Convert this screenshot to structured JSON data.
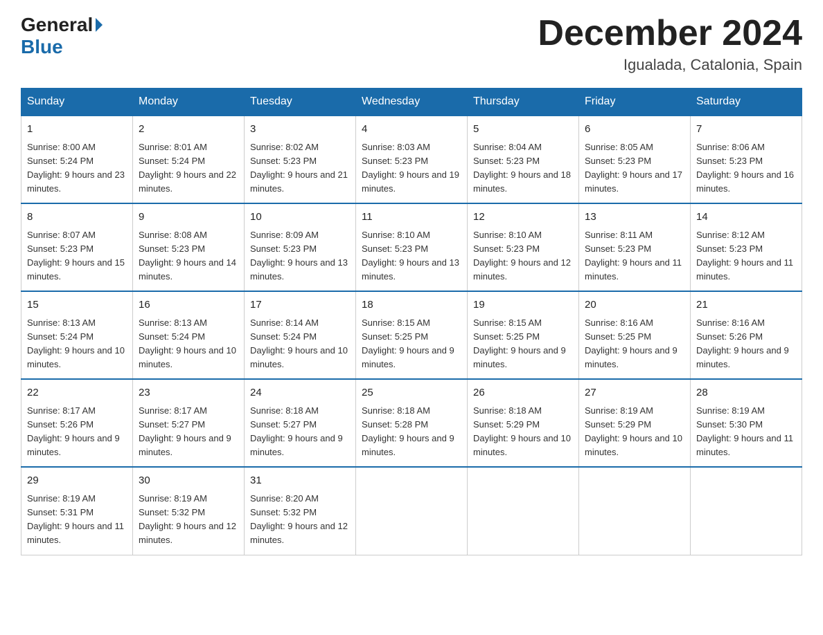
{
  "header": {
    "logo_general": "General",
    "logo_blue": "Blue",
    "title": "December 2024",
    "location": "Igualada, Catalonia, Spain"
  },
  "weekdays": [
    "Sunday",
    "Monday",
    "Tuesday",
    "Wednesday",
    "Thursday",
    "Friday",
    "Saturday"
  ],
  "weeks": [
    [
      {
        "day": "1",
        "sunrise": "8:00 AM",
        "sunset": "5:24 PM",
        "daylight": "9 hours and 23 minutes."
      },
      {
        "day": "2",
        "sunrise": "8:01 AM",
        "sunset": "5:24 PM",
        "daylight": "9 hours and 22 minutes."
      },
      {
        "day": "3",
        "sunrise": "8:02 AM",
        "sunset": "5:23 PM",
        "daylight": "9 hours and 21 minutes."
      },
      {
        "day": "4",
        "sunrise": "8:03 AM",
        "sunset": "5:23 PM",
        "daylight": "9 hours and 19 minutes."
      },
      {
        "day": "5",
        "sunrise": "8:04 AM",
        "sunset": "5:23 PM",
        "daylight": "9 hours and 18 minutes."
      },
      {
        "day": "6",
        "sunrise": "8:05 AM",
        "sunset": "5:23 PM",
        "daylight": "9 hours and 17 minutes."
      },
      {
        "day": "7",
        "sunrise": "8:06 AM",
        "sunset": "5:23 PM",
        "daylight": "9 hours and 16 minutes."
      }
    ],
    [
      {
        "day": "8",
        "sunrise": "8:07 AM",
        "sunset": "5:23 PM",
        "daylight": "9 hours and 15 minutes."
      },
      {
        "day": "9",
        "sunrise": "8:08 AM",
        "sunset": "5:23 PM",
        "daylight": "9 hours and 14 minutes."
      },
      {
        "day": "10",
        "sunrise": "8:09 AM",
        "sunset": "5:23 PM",
        "daylight": "9 hours and 13 minutes."
      },
      {
        "day": "11",
        "sunrise": "8:10 AM",
        "sunset": "5:23 PM",
        "daylight": "9 hours and 13 minutes."
      },
      {
        "day": "12",
        "sunrise": "8:10 AM",
        "sunset": "5:23 PM",
        "daylight": "9 hours and 12 minutes."
      },
      {
        "day": "13",
        "sunrise": "8:11 AM",
        "sunset": "5:23 PM",
        "daylight": "9 hours and 11 minutes."
      },
      {
        "day": "14",
        "sunrise": "8:12 AM",
        "sunset": "5:23 PM",
        "daylight": "9 hours and 11 minutes."
      }
    ],
    [
      {
        "day": "15",
        "sunrise": "8:13 AM",
        "sunset": "5:24 PM",
        "daylight": "9 hours and 10 minutes."
      },
      {
        "day": "16",
        "sunrise": "8:13 AM",
        "sunset": "5:24 PM",
        "daylight": "9 hours and 10 minutes."
      },
      {
        "day": "17",
        "sunrise": "8:14 AM",
        "sunset": "5:24 PM",
        "daylight": "9 hours and 10 minutes."
      },
      {
        "day": "18",
        "sunrise": "8:15 AM",
        "sunset": "5:25 PM",
        "daylight": "9 hours and 9 minutes."
      },
      {
        "day": "19",
        "sunrise": "8:15 AM",
        "sunset": "5:25 PM",
        "daylight": "9 hours and 9 minutes."
      },
      {
        "day": "20",
        "sunrise": "8:16 AM",
        "sunset": "5:25 PM",
        "daylight": "9 hours and 9 minutes."
      },
      {
        "day": "21",
        "sunrise": "8:16 AM",
        "sunset": "5:26 PM",
        "daylight": "9 hours and 9 minutes."
      }
    ],
    [
      {
        "day": "22",
        "sunrise": "8:17 AM",
        "sunset": "5:26 PM",
        "daylight": "9 hours and 9 minutes."
      },
      {
        "day": "23",
        "sunrise": "8:17 AM",
        "sunset": "5:27 PM",
        "daylight": "9 hours and 9 minutes."
      },
      {
        "day": "24",
        "sunrise": "8:18 AM",
        "sunset": "5:27 PM",
        "daylight": "9 hours and 9 minutes."
      },
      {
        "day": "25",
        "sunrise": "8:18 AM",
        "sunset": "5:28 PM",
        "daylight": "9 hours and 9 minutes."
      },
      {
        "day": "26",
        "sunrise": "8:18 AM",
        "sunset": "5:29 PM",
        "daylight": "9 hours and 10 minutes."
      },
      {
        "day": "27",
        "sunrise": "8:19 AM",
        "sunset": "5:29 PM",
        "daylight": "9 hours and 10 minutes."
      },
      {
        "day": "28",
        "sunrise": "8:19 AM",
        "sunset": "5:30 PM",
        "daylight": "9 hours and 11 minutes."
      }
    ],
    [
      {
        "day": "29",
        "sunrise": "8:19 AM",
        "sunset": "5:31 PM",
        "daylight": "9 hours and 11 minutes."
      },
      {
        "day": "30",
        "sunrise": "8:19 AM",
        "sunset": "5:32 PM",
        "daylight": "9 hours and 12 minutes."
      },
      {
        "day": "31",
        "sunrise": "8:20 AM",
        "sunset": "5:32 PM",
        "daylight": "9 hours and 12 minutes."
      },
      null,
      null,
      null,
      null
    ]
  ]
}
